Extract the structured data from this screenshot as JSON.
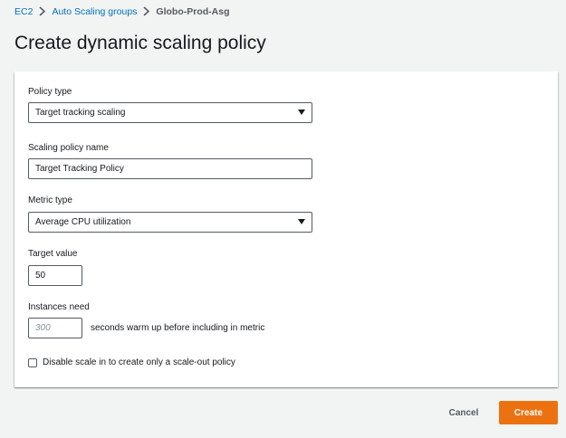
{
  "breadcrumb": {
    "items": [
      "EC2",
      "Auto Scaling groups"
    ],
    "current": "Globo-Prod-Asg"
  },
  "page": {
    "title": "Create dynamic scaling policy"
  },
  "form": {
    "policy_type": {
      "label": "Policy type",
      "value": "Target tracking scaling"
    },
    "policy_name": {
      "label": "Scaling policy name",
      "value": "Target Tracking Policy"
    },
    "metric_type": {
      "label": "Metric type",
      "value": "Average CPU utilization"
    },
    "target_value": {
      "label": "Target value",
      "value": "50"
    },
    "instances_need": {
      "label": "Instances need",
      "placeholder": "300",
      "suffix": "seconds warm up before including in metric"
    },
    "disable_scale_in": {
      "label": "Disable scale in to create only a scale-out policy",
      "checked": false
    }
  },
  "actions": {
    "cancel": "Cancel",
    "create": "Create"
  },
  "colors": {
    "primary": "#ec7211",
    "link": "#0073bb",
    "background": "#f2f3f3"
  }
}
